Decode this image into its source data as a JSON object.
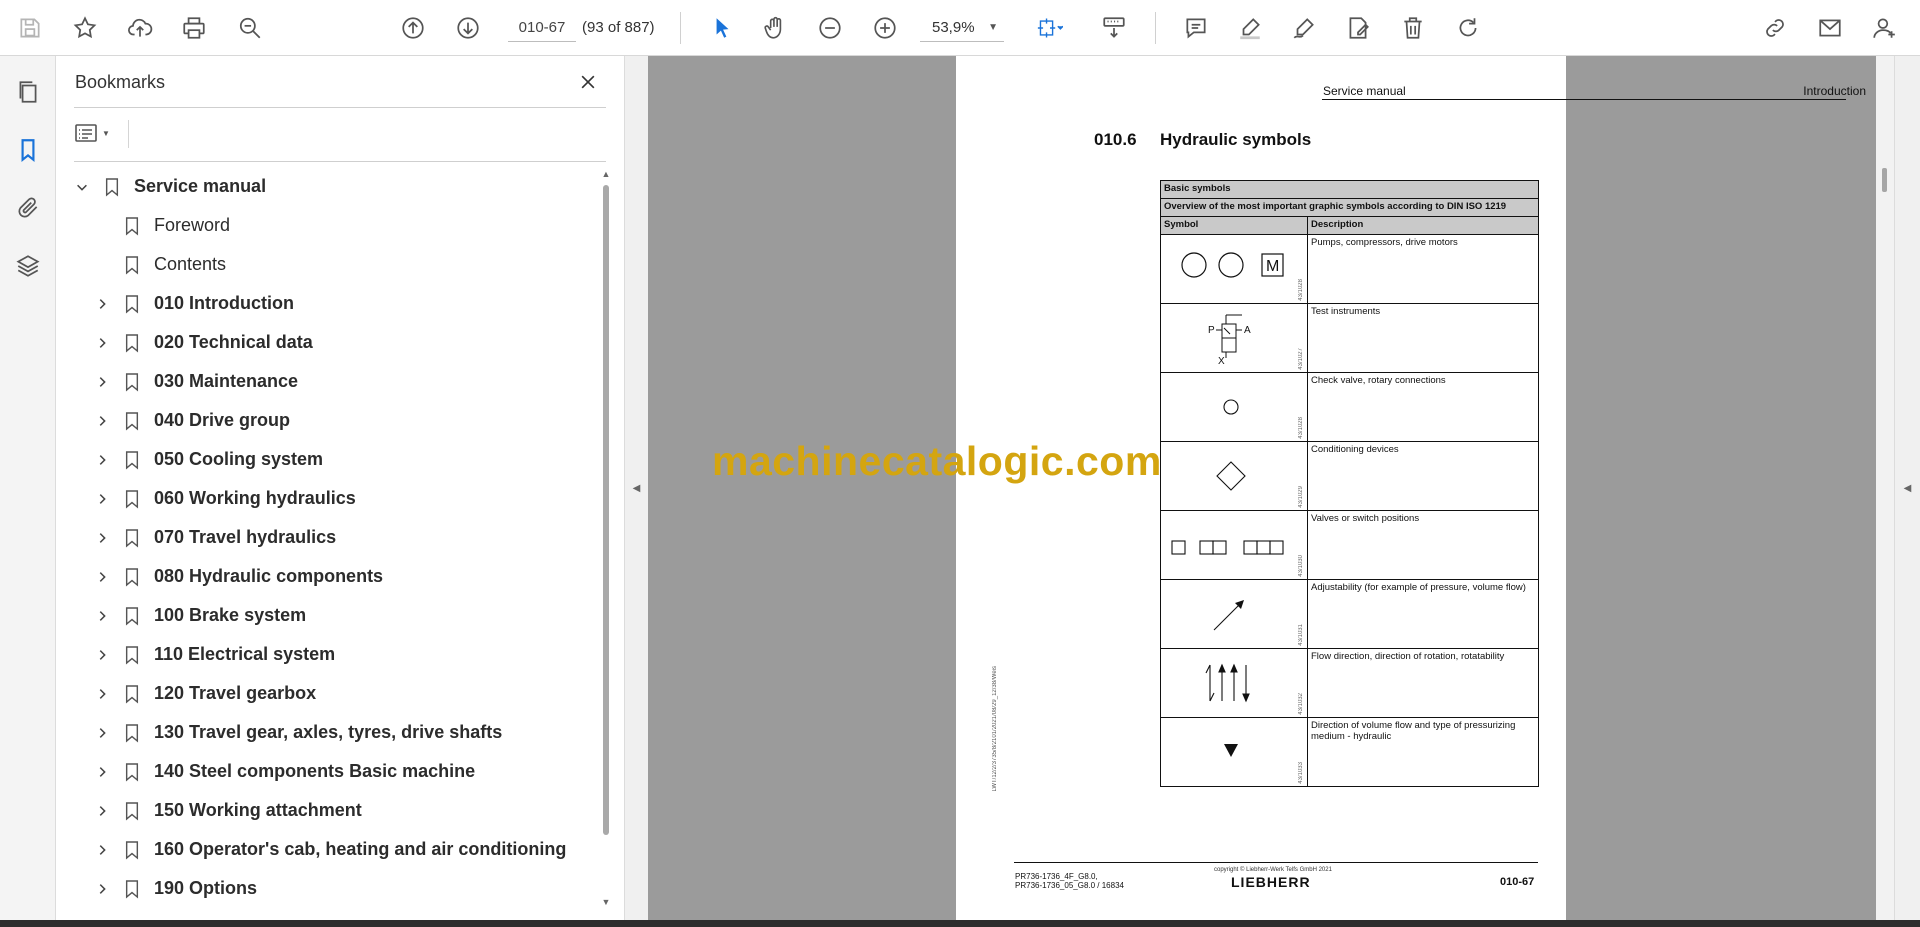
{
  "toolbar": {
    "icons": [
      "save-icon",
      "star-icon",
      "upload-icon",
      "print-icon",
      "search-zoom-icon",
      "page-up-icon",
      "page-down-icon",
      "select-cursor-icon",
      "hand-icon",
      "zoom-out-icon",
      "zoom-in-icon",
      "fit-page-icon",
      "scroll-mode-icon",
      "comment-icon",
      "highlight-icon",
      "sign-icon",
      "fill-sign-icon",
      "delete-icon",
      "rotate-icon",
      "share-link-icon",
      "email-icon",
      "account-icon"
    ],
    "page_input": "010-67",
    "page_count": "(93 of 887)",
    "zoom": "53,9%"
  },
  "leftrail": {
    "icons": [
      "pages-icon",
      "bookmark-icon",
      "attachment-icon",
      "layers-icon"
    ]
  },
  "bookmarks": {
    "title": "Bookmarks",
    "items": [
      {
        "label": "Service manual",
        "level": 0,
        "expanded": true
      },
      {
        "label": "Foreword",
        "level": 1,
        "plain": true
      },
      {
        "label": "Contents",
        "level": 1,
        "plain": true
      },
      {
        "label": "010 Introduction",
        "level": 1
      },
      {
        "label": "020 Technical data",
        "level": 1
      },
      {
        "label": "030 Maintenance",
        "level": 1
      },
      {
        "label": "040 Drive group",
        "level": 1
      },
      {
        "label": "050 Cooling system",
        "level": 1
      },
      {
        "label": "060 Working hydraulics",
        "level": 1
      },
      {
        "label": "070 Travel hydraulics",
        "level": 1
      },
      {
        "label": "080 Hydraulic components",
        "level": 1
      },
      {
        "label": "100 Brake system",
        "level": 1
      },
      {
        "label": "110 Electrical system",
        "level": 1
      },
      {
        "label": "120 Travel gearbox",
        "level": 1
      },
      {
        "label": "130 Travel gear, axles, tyres, drive shafts",
        "level": 1
      },
      {
        "label": "140 Steel components Basic machine",
        "level": 1
      },
      {
        "label": "150 Working attachment",
        "level": 1
      },
      {
        "label": "160 Operator's cab, heating and air conditioning",
        "level": 1
      },
      {
        "label": "190 Options",
        "level": 1
      }
    ]
  },
  "pdf": {
    "header_left": "Service manual",
    "header_right": "Introduction",
    "section_number": "010.6",
    "section_title": "Hydraulic symbols",
    "table": {
      "title": "Basic symbols",
      "subtitle": "Overview of the most important graphic symbols according to DIN ISO 1219",
      "col_symbol": "Symbol",
      "col_description": "Description",
      "rows": [
        {
          "fig": "43/1028",
          "symbol": "circles-m",
          "description": "Pumps, compressors, drive motors",
          "letter": "M"
        },
        {
          "fig": "43/1027",
          "symbol": "test-instrument",
          "description": "Test instruments",
          "labels": [
            "P",
            "A",
            "X"
          ]
        },
        {
          "fig": "43/1028",
          "symbol": "small-circle",
          "description": "Check valve, rotary connections"
        },
        {
          "fig": "43/1029",
          "symbol": "diamond",
          "description": "Conditioning devices"
        },
        {
          "fig": "43/1030",
          "symbol": "valve-boxes",
          "description": "Valves or switch positions"
        },
        {
          "fig": "43/1031",
          "symbol": "diagonal-arrow",
          "description": "Adjustability (for example of pressure, volume flow)"
        },
        {
          "fig": "43/1032",
          "symbol": "flow-arrows",
          "description": "Flow direction, direction of rotation, rotatability"
        },
        {
          "fig": "43/1033",
          "symbol": "filled-triangle",
          "description": "Direction of volume flow and type of pressurizing medium - hydraulic"
        }
      ]
    },
    "side_stamp": "LWT/12/2/3735/8/2101/2021/08/29_12/38/Weis",
    "footer_left_1": "PR736-1736_4F_G8.0,",
    "footer_left_2": "PR736-1736_05_G8.0 / 16834",
    "footer_copyright": "copyright © Liebherr-Werk Telfs GmbH 2021",
    "footer_logo": "LIEBHERR",
    "footer_page": "010-67"
  },
  "watermark": "machinecatalogic.com"
}
